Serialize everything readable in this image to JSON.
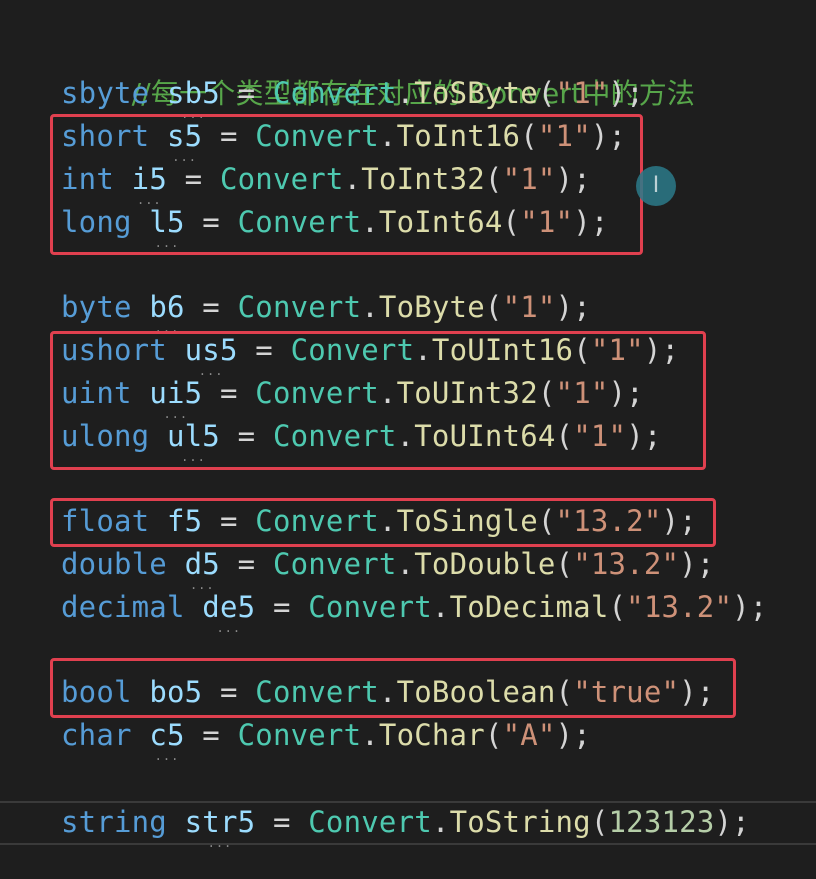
{
  "comment": "//每一个类型都存在对应的 Convert中的方法",
  "lines": [
    {
      "type": "sbyte",
      "var": "sb5",
      "cls": "Convert",
      "method": "ToSByte",
      "arg": "\"1\"",
      "argKind": "str"
    },
    {
      "type": "short",
      "var": "s5",
      "cls": "Convert",
      "method": "ToInt16",
      "arg": "\"1\"",
      "argKind": "str"
    },
    {
      "type": "int",
      "var": "i5",
      "cls": "Convert",
      "method": "ToInt32",
      "arg": "\"1\"",
      "argKind": "str"
    },
    {
      "type": "long",
      "var": "l5",
      "cls": "Convert",
      "method": "ToInt64",
      "arg": "\"1\"",
      "argKind": "str"
    },
    {
      "type": "byte",
      "var": "b6",
      "cls": "Convert",
      "method": "ToByte",
      "arg": "\"1\"",
      "argKind": "str"
    },
    {
      "type": "ushort",
      "var": "us5",
      "cls": "Convert",
      "method": "ToUInt16",
      "arg": "\"1\"",
      "argKind": "str"
    },
    {
      "type": "uint",
      "var": "ui5",
      "cls": "Convert",
      "method": "ToUInt32",
      "arg": "\"1\"",
      "argKind": "str"
    },
    {
      "type": "ulong",
      "var": "ul5",
      "cls": "Convert",
      "method": "ToUInt64",
      "arg": "\"1\"",
      "argKind": "str"
    },
    {
      "type": "float",
      "var": "f5",
      "cls": "Convert",
      "method": "ToSingle",
      "arg": "\"13.2\"",
      "argKind": "str"
    },
    {
      "type": "double",
      "var": "d5",
      "cls": "Convert",
      "method": "ToDouble",
      "arg": "\"13.2\"",
      "argKind": "str"
    },
    {
      "type": "decimal",
      "var": "de5",
      "cls": "Convert",
      "method": "ToDecimal",
      "arg": "\"13.2\"",
      "argKind": "str"
    },
    {
      "type": "bool",
      "var": "bo5",
      "cls": "Convert",
      "method": "ToBoolean",
      "arg": "\"true\"",
      "argKind": "str"
    },
    {
      "type": "char",
      "var": "c5",
      "cls": "Convert",
      "method": "ToChar",
      "arg": "\"A\"",
      "argKind": "str"
    },
    {
      "type": "string",
      "var": "str5",
      "cls": "Convert",
      "method": "ToString",
      "arg": "123123",
      "argKind": "num"
    }
  ],
  "cursor_icon": "text-cursor-icon",
  "highlight_color": "#e0404f"
}
